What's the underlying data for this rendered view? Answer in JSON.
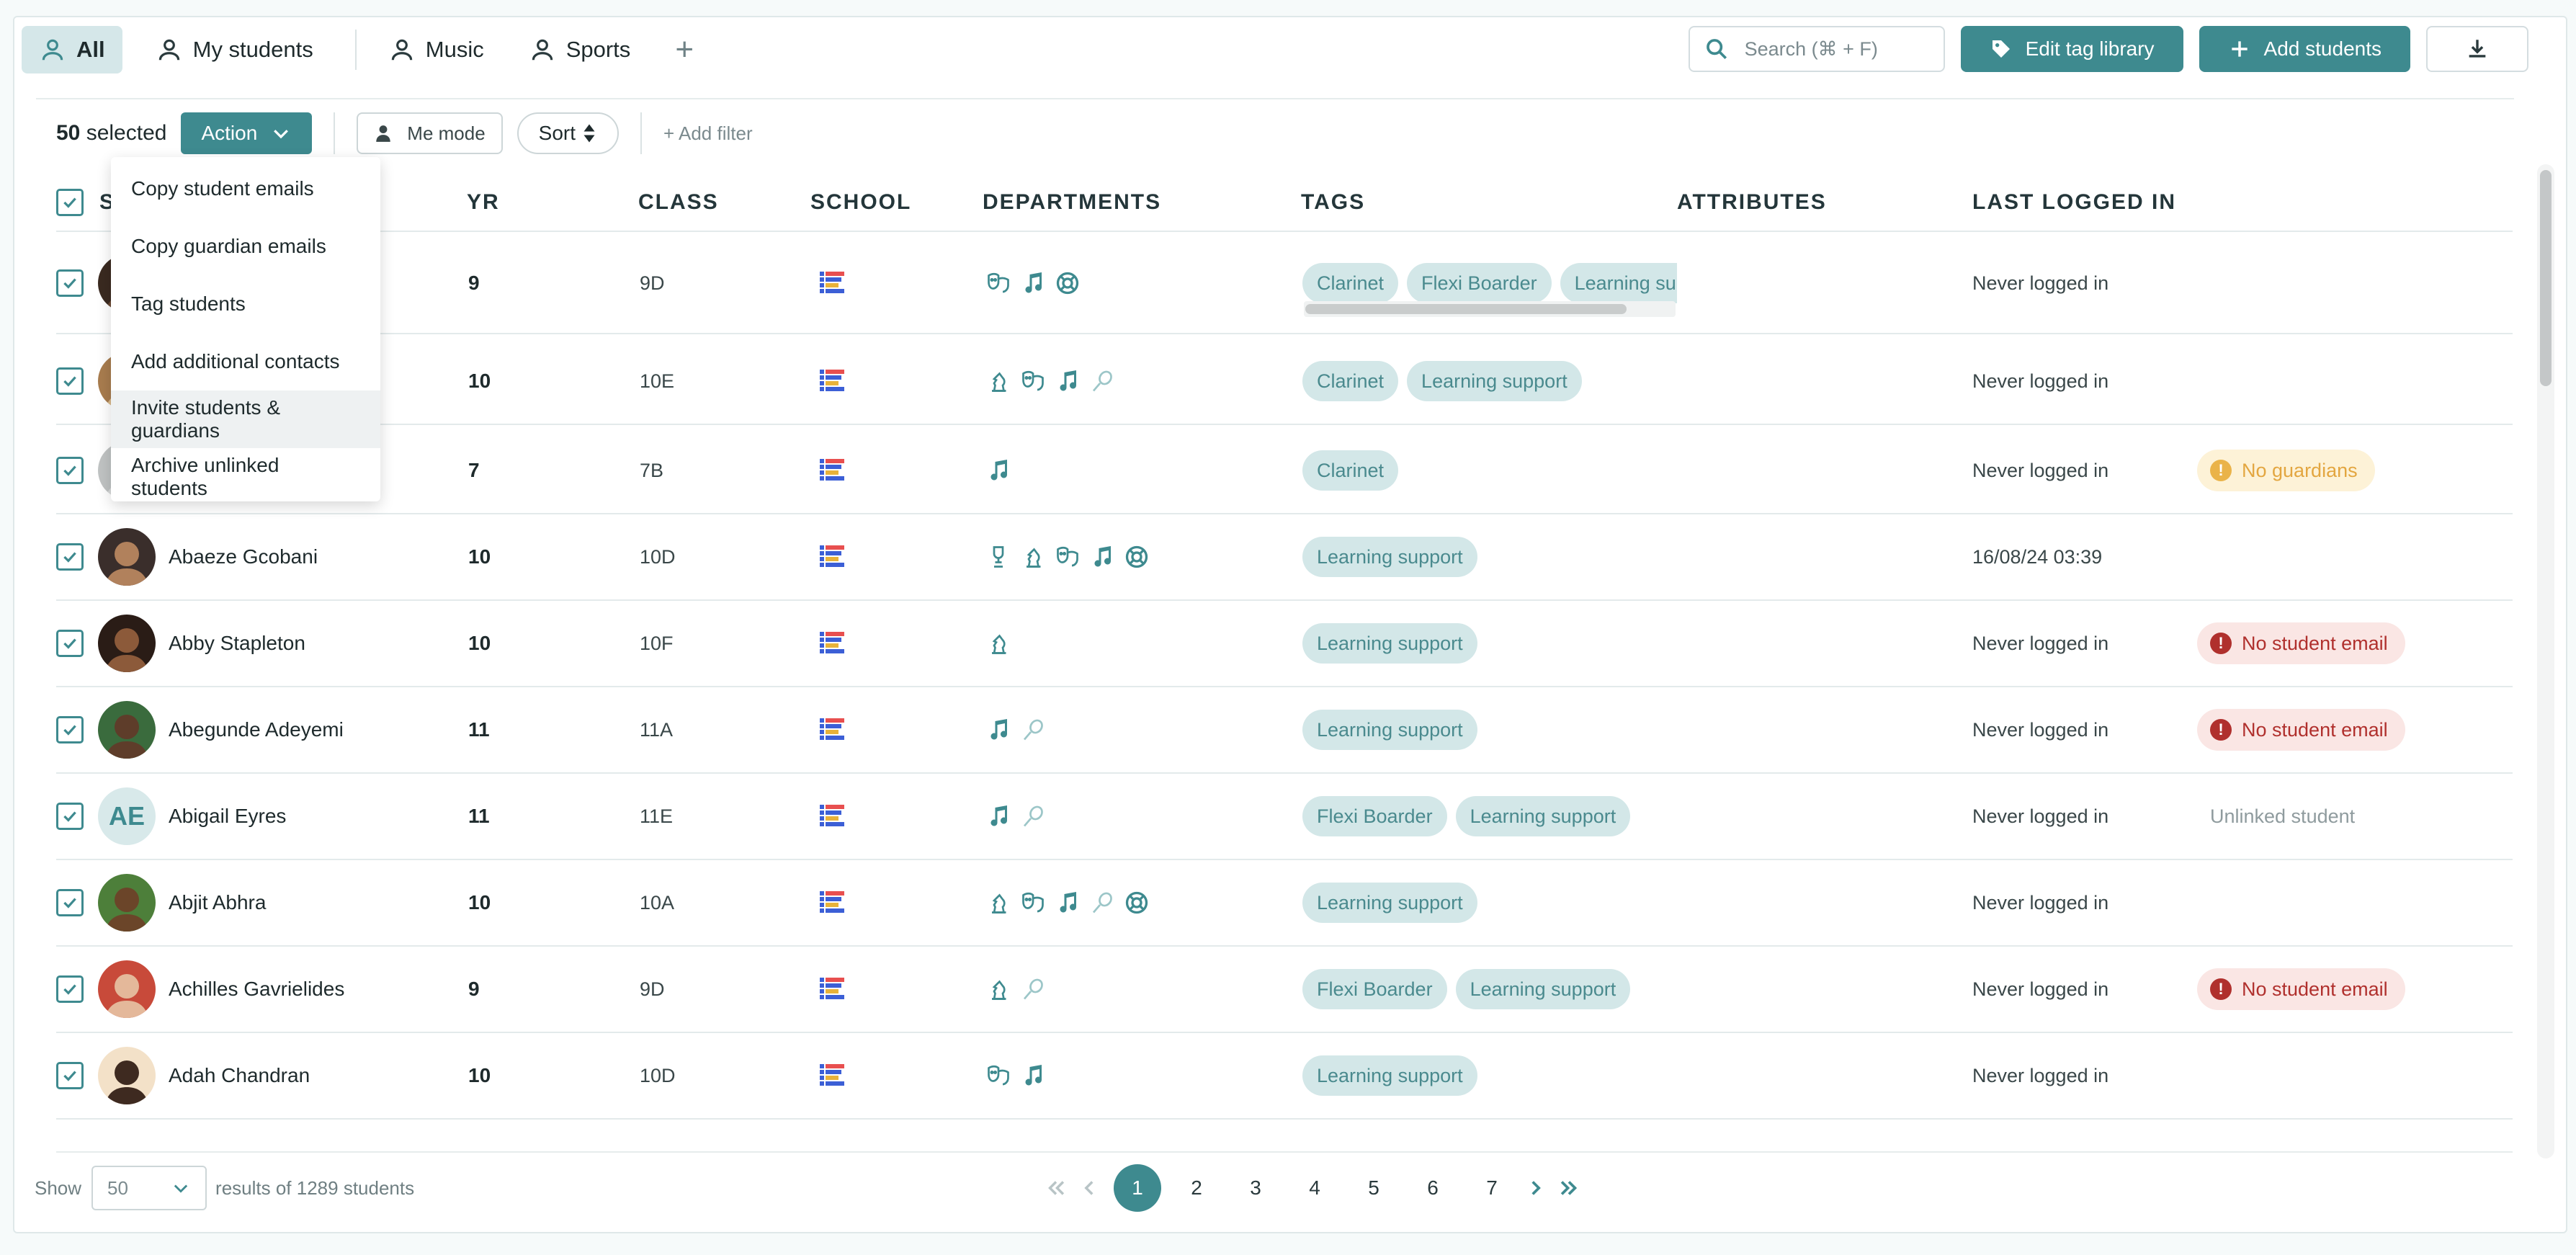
{
  "tabs": [
    {
      "label": "All",
      "active": true
    },
    {
      "label": "My students",
      "active": false
    },
    {
      "label": "Music",
      "active": false
    },
    {
      "label": "Sports",
      "active": false
    }
  ],
  "search": {
    "placeholder": "Search (⌘ + F)"
  },
  "toolbar": {
    "edit_tag_library": "Edit tag library",
    "add_students": "Add students"
  },
  "selection": {
    "count": "50",
    "suffix": " selected"
  },
  "filters": {
    "action": "Action",
    "me_mode": "Me mode",
    "sort": "Sort",
    "add_filter": "+ Add filter"
  },
  "action_menu": [
    "Copy student emails",
    "Copy guardian emails",
    "Tag students",
    "Add additional contacts",
    "Invite students & guardians",
    "Archive unlinked students"
  ],
  "columns": {
    "student": "S",
    "yr": "YR",
    "class": "CLASS",
    "school": "SCHOOL",
    "departments": "DEPARTMENTS",
    "tags": "TAGS",
    "attributes": "ATTRIBUTES",
    "last_logged_in": "LAST LOGGED IN"
  },
  "rows": [
    {
      "name": "",
      "yr": "9",
      "class": "9D",
      "depts": [
        "drama-icon",
        "music-note-icon",
        "lifebuoy-icon"
      ],
      "tags": [
        "Clarinet",
        "Flexi Boarder",
        "Learning supp"
      ],
      "last": "Never logged in",
      "status": "",
      "status_type": ""
    },
    {
      "name": "",
      "yr": "10",
      "class": "10E",
      "depts": [
        "chess-icon",
        "drama-icon",
        "music-note-icon",
        "racket-icon"
      ],
      "tags": [
        "Clarinet",
        "Learning support"
      ],
      "last": "Never logged in",
      "status": "",
      "status_type": ""
    },
    {
      "name": "",
      "yr": "7",
      "class": "7B",
      "depts": [
        "music-note-icon"
      ],
      "tags": [
        "Clarinet"
      ],
      "last": "Never logged in",
      "status": "No guardians",
      "status_type": "warn"
    },
    {
      "name": "Abaeze Gcobani",
      "yr": "10",
      "class": "10D",
      "depts": [
        "trophy-icon",
        "chess-icon",
        "drama-icon",
        "music-note-icon",
        "lifebuoy-icon"
      ],
      "tags": [
        "Learning support"
      ],
      "last": "16/08/24 03:39",
      "status": "",
      "status_type": ""
    },
    {
      "name": "Abby Stapleton",
      "yr": "10",
      "class": "10F",
      "depts": [
        "chess-icon"
      ],
      "tags": [
        "Learning support"
      ],
      "last": "Never logged in",
      "status": "No student email",
      "status_type": "err"
    },
    {
      "name": "Abegunde Adeyemi",
      "yr": "11",
      "class": "11A",
      "depts": [
        "music-note-icon",
        "racket-icon"
      ],
      "tags": [
        "Learning support"
      ],
      "last": "Never logged in",
      "status": "No student email",
      "status_type": "err"
    },
    {
      "name": "Abigail Eyres",
      "initials": "AE",
      "yr": "11",
      "class": "11E",
      "depts": [
        "music-note-icon",
        "racket-icon"
      ],
      "tags": [
        "Flexi Boarder",
        "Learning support"
      ],
      "last": "Never logged in",
      "status": "Unlinked student",
      "status_type": "plain"
    },
    {
      "name": "Abjit Abhra",
      "yr": "10",
      "class": "10A",
      "depts": [
        "chess-icon",
        "drama-icon",
        "music-note-icon",
        "racket-icon",
        "lifebuoy-icon"
      ],
      "tags": [
        "Learning support"
      ],
      "last": "Never logged in",
      "status": "",
      "status_type": ""
    },
    {
      "name": "Achilles Gavrielides",
      "yr": "9",
      "class": "9D",
      "depts": [
        "chess-icon",
        "racket-icon"
      ],
      "tags": [
        "Flexi Boarder",
        "Learning support"
      ],
      "last": "Never logged in",
      "status": "No student email",
      "status_type": "err"
    },
    {
      "name": "Adah Chandran",
      "yr": "10",
      "class": "10D",
      "depts": [
        "drama-icon",
        "music-note-icon"
      ],
      "tags": [
        "Learning support"
      ],
      "last": "Never logged in",
      "status": "",
      "status_type": ""
    }
  ],
  "footer": {
    "show": "Show",
    "page_size": "50",
    "results": "results of 1289 students",
    "pages": [
      "1",
      "2",
      "3",
      "4",
      "5",
      "6",
      "7"
    ],
    "current_page": "1"
  },
  "colors": {
    "accent": "#3e8a8f",
    "tag_bg": "#d3e7e8",
    "warn": "#e3a640",
    "error": "#b0302d"
  }
}
